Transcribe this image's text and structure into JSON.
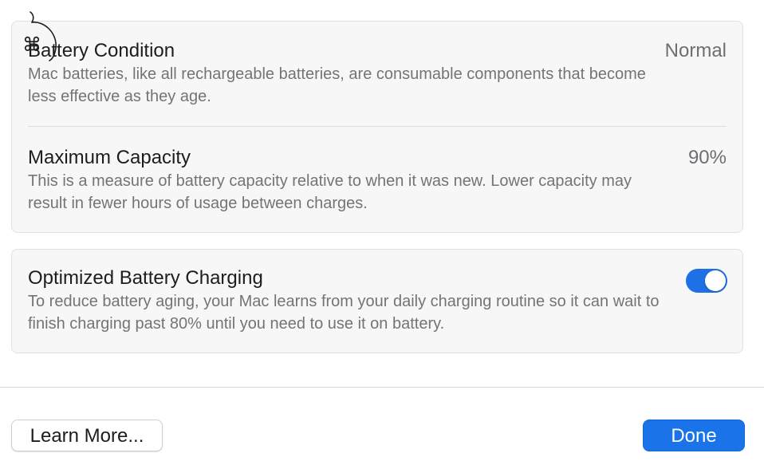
{
  "battery_condition": {
    "title": "Battery Condition",
    "value": "Normal",
    "description": "Mac batteries, like all rechargeable batteries, are consumable components that become less effective as they age."
  },
  "maximum_capacity": {
    "title": "Maximum Capacity",
    "value": "90%",
    "description": "This is a measure of battery capacity relative to when it was new. Lower capacity may result in fewer hours of usage between charges."
  },
  "optimized_charging": {
    "title": "Optimized Battery Charging",
    "description": "To reduce battery aging, your Mac learns from your daily charging routine so it can wait to finish charging past 80% until you need to use it on battery.",
    "enabled": true
  },
  "buttons": {
    "learn_more": "Learn More...",
    "done": "Done"
  },
  "overlay": {
    "command_glyph": "⌘",
    "icon": "apple-outline-icon"
  },
  "colors": {
    "accent": "#1a73e8",
    "toggle_on": "#1f6fe5"
  }
}
